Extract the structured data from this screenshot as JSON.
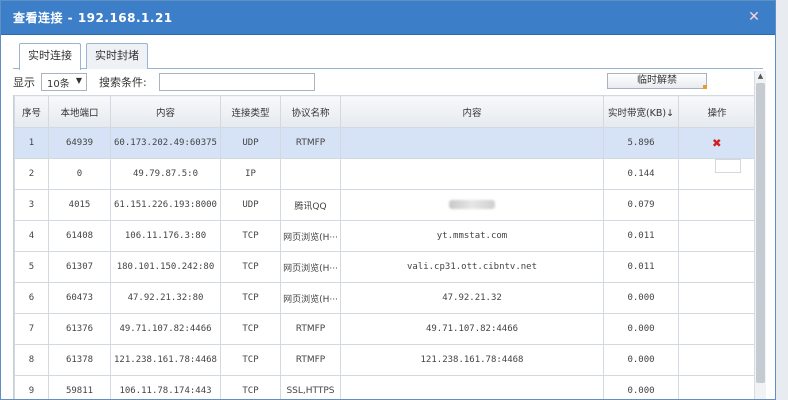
{
  "dialog": {
    "title": "查看连接 - 192.168.1.21",
    "close_glyph": "✕"
  },
  "tabs": [
    {
      "label": "实时连接",
      "active": true
    },
    {
      "label": "实时封堵",
      "active": false
    }
  ],
  "toolbar": {
    "show_label": "显示",
    "page_size": "10条",
    "search_label": "搜索条件:",
    "search_value": "",
    "unblock_label": "临时解禁"
  },
  "table": {
    "headers": [
      "序号",
      "本地端口",
      "内容",
      "连接类型",
      "协议名称",
      "内容",
      "实时带宽(KB)↓",
      "操作"
    ],
    "rows": [
      {
        "idx": "1",
        "port": "64939",
        "content": "60.173.202.49:60375",
        "type": "UDP",
        "protocol": "RTMFP",
        "detail": "",
        "bw": "5.896",
        "op": "delete",
        "selected": true
      },
      {
        "idx": "2",
        "port": "0",
        "content": "49.79.87.5:0",
        "type": "IP",
        "protocol": "",
        "detail": "",
        "bw": "0.144",
        "op": ""
      },
      {
        "idx": "3",
        "port": "4015",
        "content": "61.151.226.193:8000",
        "type": "UDP",
        "protocol": "腾讯QQ",
        "detail": "blurred",
        "bw": "0.079",
        "op": ""
      },
      {
        "idx": "4",
        "port": "61408",
        "content": "106.11.176.3:80",
        "type": "TCP",
        "protocol": "网页浏览(H···",
        "detail": "yt.mmstat.com",
        "bw": "0.011",
        "op": ""
      },
      {
        "idx": "5",
        "port": "61307",
        "content": "180.101.150.242:80",
        "type": "TCP",
        "protocol": "网页浏览(H···",
        "detail": "vali.cp31.ott.cibntv.net",
        "bw": "0.011",
        "op": ""
      },
      {
        "idx": "6",
        "port": "60473",
        "content": "47.92.21.32:80",
        "type": "TCP",
        "protocol": "网页浏览(H···",
        "detail": "47.92.21.32",
        "bw": "0.000",
        "op": ""
      },
      {
        "idx": "7",
        "port": "61376",
        "content": "49.71.107.82:4466",
        "type": "TCP",
        "protocol": "RTMFP",
        "detail": "49.71.107.82:4466",
        "bw": "0.000",
        "op": ""
      },
      {
        "idx": "8",
        "port": "61378",
        "content": "121.238.161.78:4468",
        "type": "TCP",
        "protocol": "RTMFP",
        "detail": "121.238.161.78:4468",
        "bw": "0.000",
        "op": ""
      },
      {
        "idx": "9",
        "port": "59811",
        "content": "106.11.78.174:443",
        "type": "TCP",
        "protocol": "SSL,HTTPS",
        "detail": "",
        "bw": "0.000",
        "op": ""
      }
    ]
  },
  "icons": {
    "delete": "delete-x-icon",
    "close": "close-icon",
    "dropdown": "chevron-down-icon"
  },
  "colors": {
    "titlebar": "#3c7ec8",
    "selected_row": "#d6e2f5",
    "delete_icon": "#d21e1e"
  }
}
